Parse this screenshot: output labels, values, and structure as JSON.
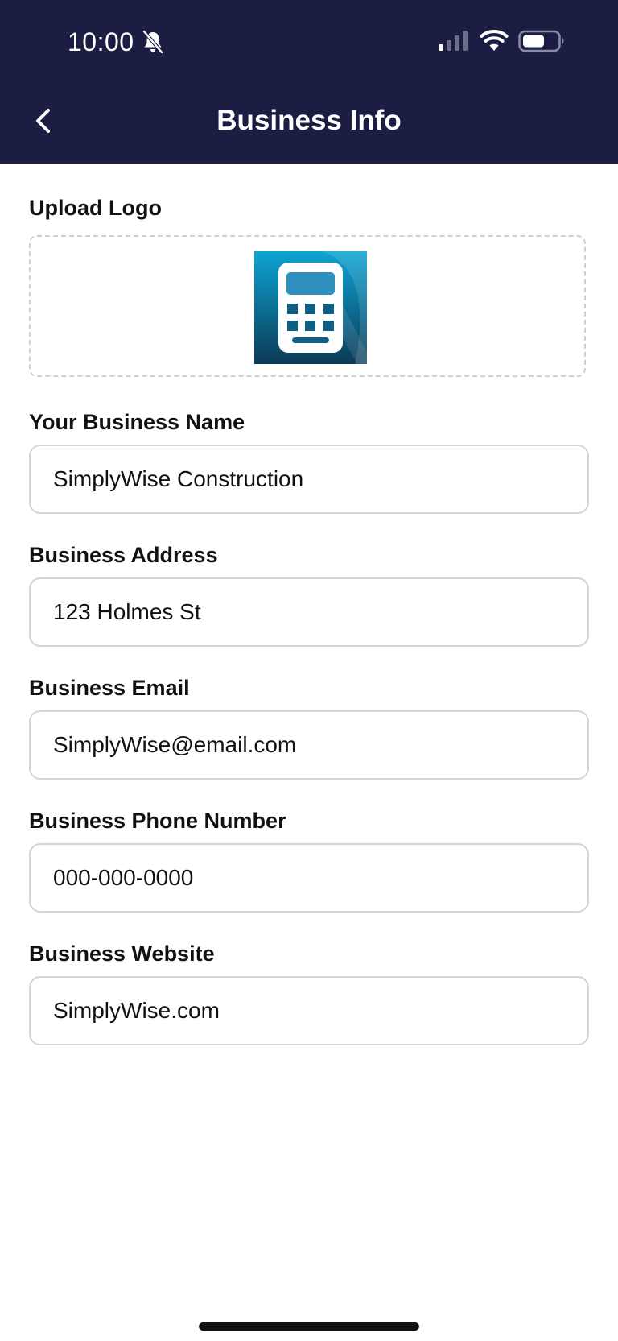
{
  "status_bar": {
    "time": "10:00"
  },
  "header": {
    "title": "Business Info",
    "background": "#1b1e42"
  },
  "upload": {
    "label": "Upload Logo",
    "logo_gradient_top": "#0ea4d4",
    "logo_gradient_bottom": "#0b3a55"
  },
  "fields": {
    "business_name": {
      "label": "Your Business Name",
      "value": "SimplyWise Construction"
    },
    "business_address": {
      "label": "Business Address",
      "value": "123 Holmes St"
    },
    "business_email": {
      "label": "Business Email",
      "value": "SimplyWise@email.com"
    },
    "business_phone": {
      "label": "Business Phone Number",
      "value": "000-000-0000"
    },
    "business_website": {
      "label": "Business Website",
      "value": "SimplyWise.com"
    }
  },
  "icons": {
    "back": "chevron-left-icon",
    "bell": "bell-slash-icon",
    "signal": "cellular-signal-icon",
    "wifi": "wifi-icon",
    "battery": "battery-icon",
    "logo": "calculator-icon"
  }
}
